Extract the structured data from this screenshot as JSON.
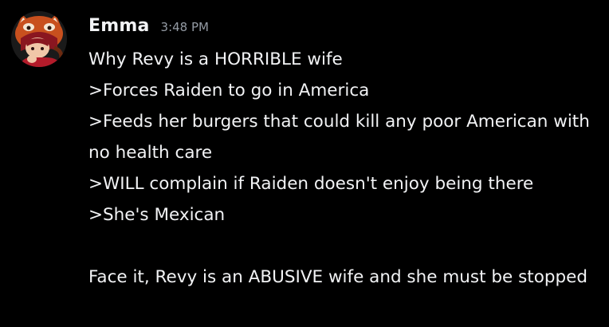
{
  "message": {
    "author": "Emma",
    "timestamp": "3:48 PM",
    "avatar_icon": "red-panda-hood-avatar-icon",
    "lines": [
      "Why Revy is a HORRIBLE wife",
      ">Forces Raiden to go in America",
      ">Feeds her burgers that could kill any poor American with no health care",
      ">WILL complain if Raiden doesn't enjoy being there",
      ">She's Mexican",
      "",
      "Face it, Revy is an ABUSIVE wife and she must be stopped"
    ]
  },
  "colors": {
    "background": "#000000",
    "text": "#f2f3f5",
    "timestamp": "#949ba4"
  }
}
